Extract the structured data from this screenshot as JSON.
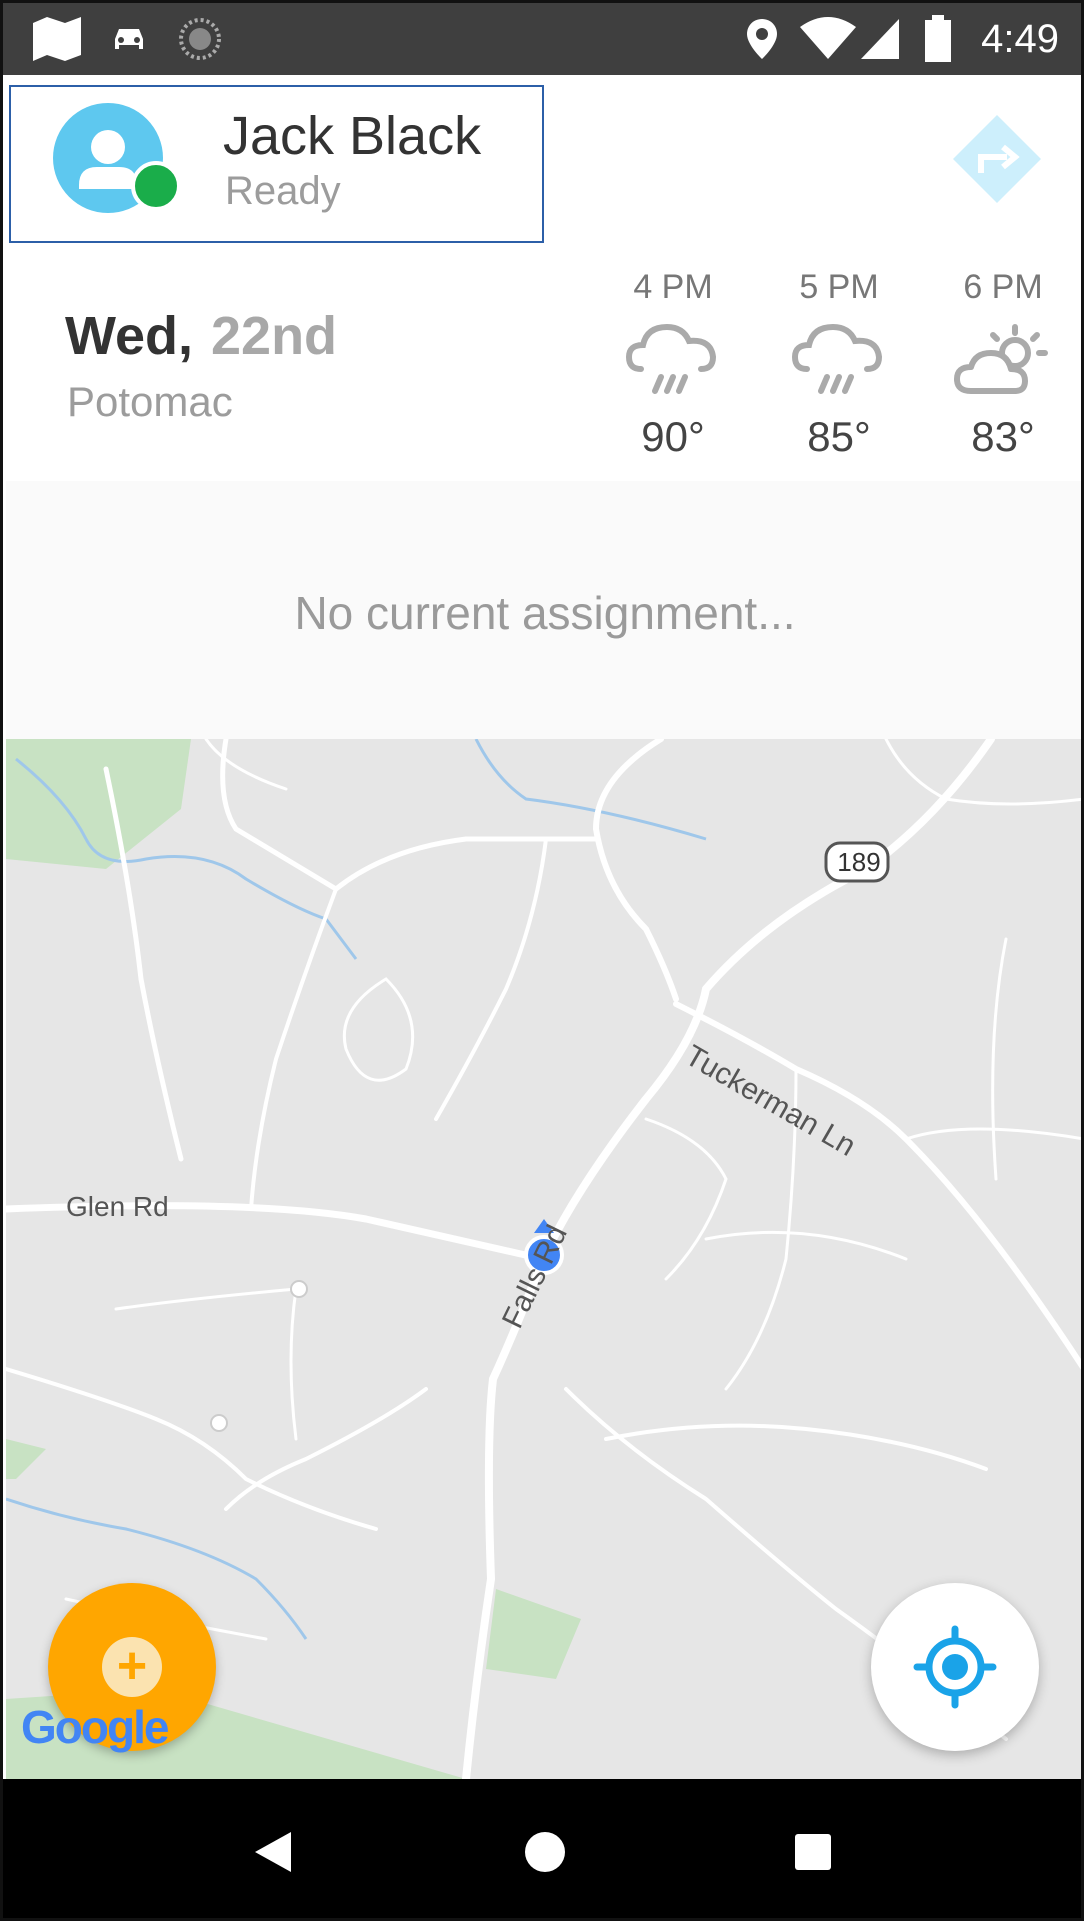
{
  "status_bar": {
    "time": "4:49",
    "left_icons": [
      "map-icon",
      "car-icon",
      "sync-icon"
    ],
    "right_icons": [
      "location-pin-icon",
      "wifi-icon",
      "signal-icon",
      "battery-icon"
    ]
  },
  "header": {
    "driver_name": "Jack Black",
    "driver_status": "Ready",
    "avatar_icon": "person-icon",
    "online_indicator_color": "#1aad4a",
    "nav_icon": "directions-icon"
  },
  "date_block": {
    "day": "Wed,",
    "date": "22nd",
    "city": "Potomac"
  },
  "forecast": [
    {
      "time": "4 PM",
      "icon": "rain-cloud-icon",
      "temp": "90°"
    },
    {
      "time": "5 PM",
      "icon": "rain-cloud-icon",
      "temp": "85°"
    },
    {
      "time": "6 PM",
      "icon": "partly-sunny-icon",
      "temp": "83°"
    }
  ],
  "assignment": {
    "message": "No current assignment..."
  },
  "map": {
    "labels": {
      "glen_rd": "Glen Rd",
      "tuckerman": "Tuckerman Ln",
      "falls_rd": "Falls Rd",
      "route": "189"
    },
    "provider": "Google"
  },
  "fabs": {
    "add_icon": "plus-icon",
    "add_symbol": "+",
    "add_color": "#ffa600",
    "locate_icon": "crosshair-icon",
    "locate_color": "#1aa3e8"
  },
  "nav_bar": {
    "buttons": [
      "back-icon",
      "home-icon",
      "recents-icon"
    ]
  }
}
